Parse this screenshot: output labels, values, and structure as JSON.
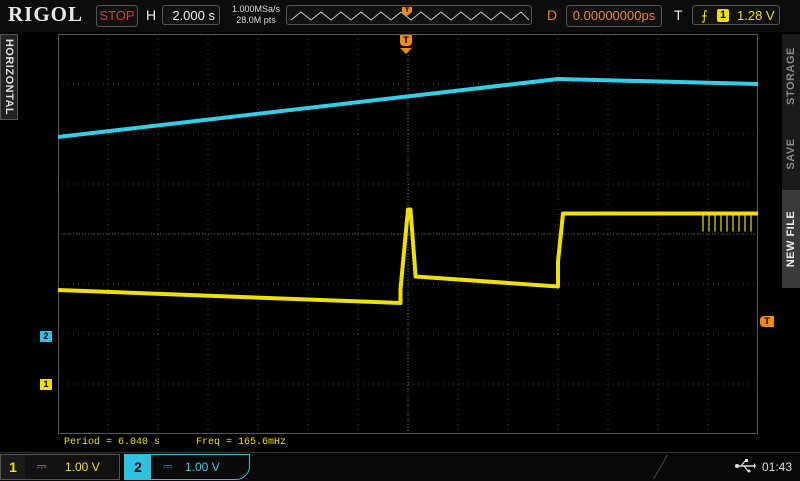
{
  "header": {
    "brand": "RIGOL",
    "run_status": "STOP",
    "horizontal_label": "H",
    "timebase": "2.000 s",
    "sample_rate": "1.000MSa/s",
    "memory_depth": "28.0M pts",
    "delay_label": "D",
    "delay_value": "0.00000000ps",
    "trigger_label": "T",
    "trigger_source": "1",
    "trigger_level": "1.28 V",
    "colors": {
      "run_status": "#e33333",
      "delay": "#f08a1c",
      "trigger": "#f0e000"
    }
  },
  "side_menu": {
    "left_tab": "HORIZONTAL",
    "right_tabs": [
      "STORAGE",
      "SAVE",
      "NEW FILE"
    ],
    "active_right_tab": "NEW FILE"
  },
  "markers": {
    "trigger_position": "T",
    "trigger_level": "T",
    "ch2_ground": "2",
    "ch1_ground": "1"
  },
  "measurements": {
    "period": "Period = 6.040 s",
    "frequency": "Freq = 165.6mHz"
  },
  "channels": [
    {
      "id": "1",
      "coupling_icon": "dc-coupling-icon",
      "coupling_glyph": "⎓",
      "scale": "1.00 V",
      "color": "#f0e000",
      "active": false
    },
    {
      "id": "2",
      "coupling_icon": "dc-coupling-icon",
      "coupling_glyph": "⎓",
      "scale": "1.00 V",
      "color": "#30d0e8",
      "active": true
    }
  ],
  "status": {
    "usb_icon": "usb-icon",
    "usb_glyph": "⭠",
    "time": "01:43"
  },
  "chart_data": {
    "type": "line",
    "title": "",
    "xlabel": "",
    "ylabel": "",
    "x_unit": "s",
    "x_divisions": 14,
    "y_divisions": 8,
    "xlim": [
      -14,
      14
    ],
    "grid": true,
    "series": [
      {
        "name": "1",
        "color": "#f0e000",
        "x": [
          -14,
          -0.3,
          -0.3,
          0,
          0.1,
          0.3,
          0.3,
          6.0,
          6.0,
          6.2,
          14
        ],
        "y": [
          -1.12,
          -1.38,
          -1.1,
          0.49,
          0.49,
          -0.82,
          -0.85,
          -1.05,
          -0.55,
          0.41,
          0.41
        ]
      },
      {
        "name": "2",
        "color": "#30d0e8",
        "x": [
          -14,
          6.0,
          14
        ],
        "y": [
          1.94,
          3.1,
          3.0
        ]
      }
    ]
  }
}
